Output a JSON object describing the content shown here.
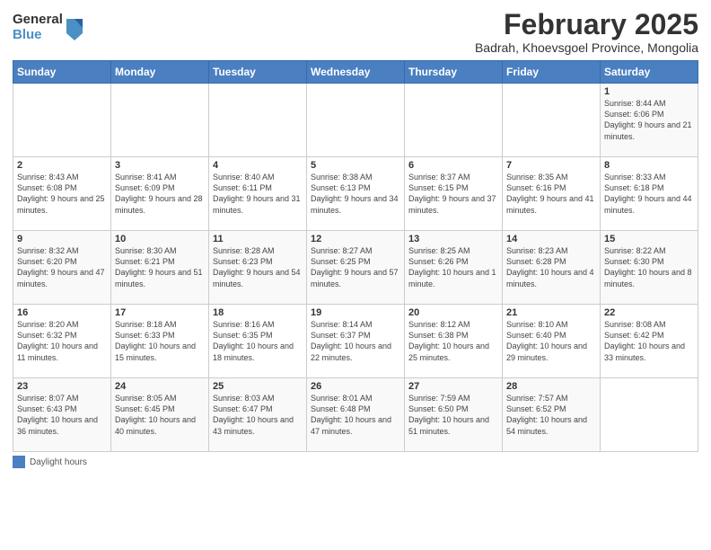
{
  "header": {
    "logo_general": "General",
    "logo_blue": "Blue",
    "month_title": "February 2025",
    "location": "Badrah, Khoevsgoel Province, Mongolia"
  },
  "weekdays": [
    "Sunday",
    "Monday",
    "Tuesday",
    "Wednesday",
    "Thursday",
    "Friday",
    "Saturday"
  ],
  "weeks": [
    [
      {
        "day": "",
        "info": ""
      },
      {
        "day": "",
        "info": ""
      },
      {
        "day": "",
        "info": ""
      },
      {
        "day": "",
        "info": ""
      },
      {
        "day": "",
        "info": ""
      },
      {
        "day": "",
        "info": ""
      },
      {
        "day": "1",
        "info": "Sunrise: 8:44 AM\nSunset: 6:06 PM\nDaylight: 9 hours and 21 minutes."
      }
    ],
    [
      {
        "day": "2",
        "info": "Sunrise: 8:43 AM\nSunset: 6:08 PM\nDaylight: 9 hours and 25 minutes."
      },
      {
        "day": "3",
        "info": "Sunrise: 8:41 AM\nSunset: 6:09 PM\nDaylight: 9 hours and 28 minutes."
      },
      {
        "day": "4",
        "info": "Sunrise: 8:40 AM\nSunset: 6:11 PM\nDaylight: 9 hours and 31 minutes."
      },
      {
        "day": "5",
        "info": "Sunrise: 8:38 AM\nSunset: 6:13 PM\nDaylight: 9 hours and 34 minutes."
      },
      {
        "day": "6",
        "info": "Sunrise: 8:37 AM\nSunset: 6:15 PM\nDaylight: 9 hours and 37 minutes."
      },
      {
        "day": "7",
        "info": "Sunrise: 8:35 AM\nSunset: 6:16 PM\nDaylight: 9 hours and 41 minutes."
      },
      {
        "day": "8",
        "info": "Sunrise: 8:33 AM\nSunset: 6:18 PM\nDaylight: 9 hours and 44 minutes."
      }
    ],
    [
      {
        "day": "9",
        "info": "Sunrise: 8:32 AM\nSunset: 6:20 PM\nDaylight: 9 hours and 47 minutes."
      },
      {
        "day": "10",
        "info": "Sunrise: 8:30 AM\nSunset: 6:21 PM\nDaylight: 9 hours and 51 minutes."
      },
      {
        "day": "11",
        "info": "Sunrise: 8:28 AM\nSunset: 6:23 PM\nDaylight: 9 hours and 54 minutes."
      },
      {
        "day": "12",
        "info": "Sunrise: 8:27 AM\nSunset: 6:25 PM\nDaylight: 9 hours and 57 minutes."
      },
      {
        "day": "13",
        "info": "Sunrise: 8:25 AM\nSunset: 6:26 PM\nDaylight: 10 hours and 1 minute."
      },
      {
        "day": "14",
        "info": "Sunrise: 8:23 AM\nSunset: 6:28 PM\nDaylight: 10 hours and 4 minutes."
      },
      {
        "day": "15",
        "info": "Sunrise: 8:22 AM\nSunset: 6:30 PM\nDaylight: 10 hours and 8 minutes."
      }
    ],
    [
      {
        "day": "16",
        "info": "Sunrise: 8:20 AM\nSunset: 6:32 PM\nDaylight: 10 hours and 11 minutes."
      },
      {
        "day": "17",
        "info": "Sunrise: 8:18 AM\nSunset: 6:33 PM\nDaylight: 10 hours and 15 minutes."
      },
      {
        "day": "18",
        "info": "Sunrise: 8:16 AM\nSunset: 6:35 PM\nDaylight: 10 hours and 18 minutes."
      },
      {
        "day": "19",
        "info": "Sunrise: 8:14 AM\nSunset: 6:37 PM\nDaylight: 10 hours and 22 minutes."
      },
      {
        "day": "20",
        "info": "Sunrise: 8:12 AM\nSunset: 6:38 PM\nDaylight: 10 hours and 25 minutes."
      },
      {
        "day": "21",
        "info": "Sunrise: 8:10 AM\nSunset: 6:40 PM\nDaylight: 10 hours and 29 minutes."
      },
      {
        "day": "22",
        "info": "Sunrise: 8:08 AM\nSunset: 6:42 PM\nDaylight: 10 hours and 33 minutes."
      }
    ],
    [
      {
        "day": "23",
        "info": "Sunrise: 8:07 AM\nSunset: 6:43 PM\nDaylight: 10 hours and 36 minutes."
      },
      {
        "day": "24",
        "info": "Sunrise: 8:05 AM\nSunset: 6:45 PM\nDaylight: 10 hours and 40 minutes."
      },
      {
        "day": "25",
        "info": "Sunrise: 8:03 AM\nSunset: 6:47 PM\nDaylight: 10 hours and 43 minutes."
      },
      {
        "day": "26",
        "info": "Sunrise: 8:01 AM\nSunset: 6:48 PM\nDaylight: 10 hours and 47 minutes."
      },
      {
        "day": "27",
        "info": "Sunrise: 7:59 AM\nSunset: 6:50 PM\nDaylight: 10 hours and 51 minutes."
      },
      {
        "day": "28",
        "info": "Sunrise: 7:57 AM\nSunset: 6:52 PM\nDaylight: 10 hours and 54 minutes."
      },
      {
        "day": "",
        "info": ""
      }
    ]
  ],
  "footer": {
    "box_label": "Daylight hours"
  }
}
